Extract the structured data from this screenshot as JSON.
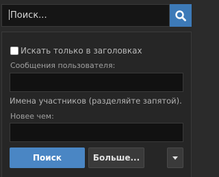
{
  "search": {
    "value": "Поиск...",
    "button_icon": "search-icon"
  },
  "options": {
    "titles_only_label": "Искать только в заголовках",
    "titles_only_checked": false,
    "user_posts_label": "Сообщения пользователя:",
    "user_posts_value": "",
    "members_hint": "Имена участников (разделяйте запятой).",
    "newer_than_label": "Новее чем:",
    "newer_than_value": ""
  },
  "actions": {
    "search_label": "Поиск",
    "more_label": "Больше...",
    "dropdown_icon": "caret-down-icon"
  },
  "colors": {
    "accent": "#4a86c4",
    "search_button": "#3d7ab8",
    "background": "#262626"
  }
}
